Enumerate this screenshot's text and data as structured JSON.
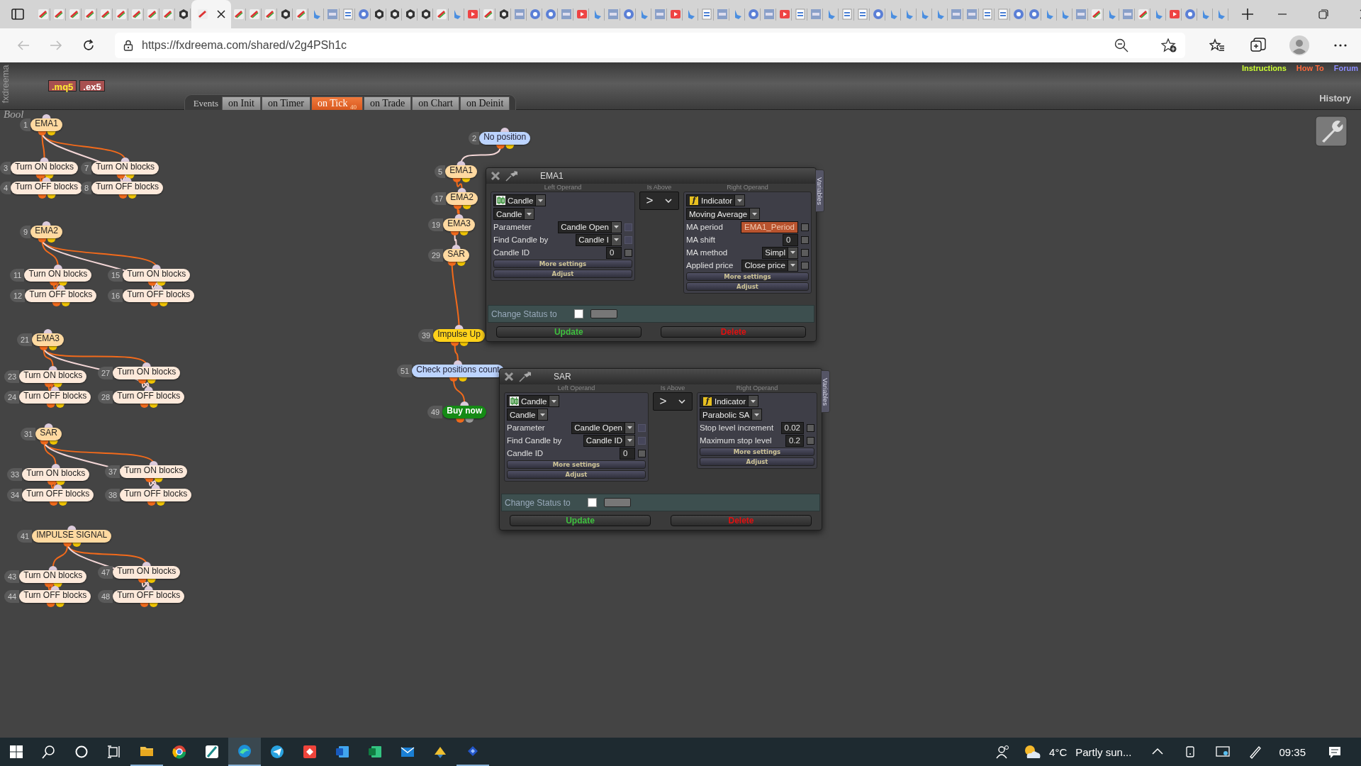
{
  "browser": {
    "url": "https://fxdreema.com/shared/v2g4PSh1c"
  },
  "header": {
    "side_label": "fxdreema",
    "canvas_label": "Bool",
    "downloads": [
      {
        "label": ".mq5",
        "kind": "source"
      },
      {
        "label": ".ex5",
        "kind": "binary"
      }
    ],
    "links": [
      {
        "label": "Instructions",
        "color": "#ccff33"
      },
      {
        "label": "How To",
        "color": "#ff6a3d"
      },
      {
        "label": "Forum",
        "color": "#8c8cff"
      }
    ],
    "history": "History"
  },
  "events_label": "Events",
  "event_tabs": [
    {
      "label": "on Init",
      "selected": false
    },
    {
      "label": "on Timer",
      "selected": false
    },
    {
      "label": "on Tick $_{40}$",
      "selected": true
    },
    {
      "label": "on Trade",
      "selected": false
    },
    {
      "label": "on Chart",
      "selected": false
    },
    {
      "label": "on Deinit",
      "selected": false
    }
  ],
  "blocks": [
    {
      "number": "1",
      "label": "EMA1",
      "kind": "condition"
    },
    {
      "number": "3",
      "label": "Turn ON blocks",
      "kind": "action"
    },
    {
      "number": "7",
      "label": "Turn ON blocks",
      "kind": "action"
    },
    {
      "number": "4",
      "label": "Turn OFF blocks",
      "kind": "action"
    },
    {
      "number": "8",
      "label": "Turn OFF blocks",
      "kind": "action"
    },
    {
      "number": "9",
      "label": "EMA2",
      "kind": "condition"
    },
    {
      "number": "11",
      "label": "Turn ON blocks",
      "kind": "action"
    },
    {
      "number": "15",
      "label": "Turn ON blocks",
      "kind": "action"
    },
    {
      "number": "12",
      "label": "Turn OFF blocks",
      "kind": "action"
    },
    {
      "number": "16",
      "label": "Turn OFF blocks",
      "kind": "action"
    },
    {
      "number": "21",
      "label": "EMA3",
      "kind": "condition"
    },
    {
      "number": "23",
      "label": "Turn ON blocks",
      "kind": "action"
    },
    {
      "number": "27",
      "label": "Turn ON blocks",
      "kind": "action"
    },
    {
      "number": "24",
      "label": "Turn OFF blocks",
      "kind": "action"
    },
    {
      "number": "28",
      "label": "Turn OFF blocks",
      "kind": "action"
    },
    {
      "number": "31",
      "label": "SAR",
      "kind": "condition"
    },
    {
      "number": "33",
      "label": "Turn ON blocks",
      "kind": "action"
    },
    {
      "number": "37",
      "label": "Turn ON blocks",
      "kind": "action"
    },
    {
      "number": "34",
      "label": "Turn OFF blocks",
      "kind": "action"
    },
    {
      "number": "38",
      "label": "Turn OFF blocks",
      "kind": "action"
    },
    {
      "number": "41",
      "label": "IMPULSE SIGNAL",
      "kind": "condition"
    },
    {
      "number": "43",
      "label": "Turn ON blocks",
      "kind": "action"
    },
    {
      "number": "47",
      "label": "Turn ON blocks",
      "kind": "action"
    },
    {
      "number": "44",
      "label": "Turn OFF blocks",
      "kind": "action"
    },
    {
      "number": "48",
      "label": "Turn OFF blocks",
      "kind": "action"
    },
    {
      "number": "2",
      "label": "No position",
      "kind": "filter"
    },
    {
      "number": "5",
      "label": "EMA1",
      "kind": "condition"
    },
    {
      "number": "17",
      "label": "EMA2",
      "kind": "condition"
    },
    {
      "number": "19",
      "label": "EMA3",
      "kind": "condition"
    },
    {
      "number": "29",
      "label": "SAR",
      "kind": "condition"
    },
    {
      "number": "39",
      "label": "Impulse Up",
      "kind": "signal"
    },
    {
      "number": "51",
      "label": "Check positions count",
      "kind": "filter"
    },
    {
      "number": "49",
      "label": "Buy now",
      "kind": "buy"
    }
  ],
  "dialogs": [
    {
      "title": "EMA1",
      "side_tab": "Variables",
      "left_heading": "Left Operand",
      "operator_heading": "Is Above",
      "right_heading": "Right Operand",
      "operator": ">",
      "left": {
        "source": {
          "kind": "candle",
          "label": "Candle"
        },
        "subtype": "Candle",
        "params": [
          {
            "label": "Parameter",
            "kind": "select",
            "value": "Candle Open",
            "checked": false,
            "disabled": true
          },
          {
            "label": "Find Candle by",
            "kind": "select",
            "value": "Candle I",
            "checked": false,
            "disabled": true
          },
          {
            "label": "Candle ID",
            "kind": "number",
            "value": "0",
            "checked": false,
            "disabled": false
          }
        ],
        "buttons": [
          "More settings",
          "Adjust"
        ]
      },
      "right": {
        "source": {
          "kind": "indicator",
          "glyph": "f",
          "label": "Indicator"
        },
        "subtype": "Moving Average",
        "params": [
          {
            "label": "MA period",
            "kind": "variable",
            "value": "EMA1_Period",
            "checked": false,
            "disabled": false
          },
          {
            "label": "MA shift",
            "kind": "number",
            "value": "0",
            "checked": false,
            "disabled": false
          },
          {
            "label": "MA method",
            "kind": "select",
            "value": "Simpl",
            "checked": false,
            "disabled": false
          },
          {
            "label": "Applied price",
            "kind": "select",
            "value": "Close price",
            "checked": false,
            "disabled": false
          }
        ],
        "buttons": [
          "More settings",
          "Adjust"
        ]
      },
      "status": {
        "label": "Change Status to",
        "checked": false
      },
      "actions": [
        {
          "label": "Update",
          "kind": "update"
        },
        {
          "label": "Delete",
          "kind": "delete"
        }
      ]
    },
    {
      "title": "SAR",
      "side_tab": "Variables",
      "left_heading": "Left Operand",
      "operator_heading": "Is Above",
      "right_heading": "Right Operand",
      "operator": ">",
      "left": {
        "source": {
          "kind": "candle",
          "label": "Candle"
        },
        "subtype": "Candle",
        "params": [
          {
            "label": "Parameter",
            "kind": "select",
            "value": "Candle Open",
            "checked": false,
            "disabled": true
          },
          {
            "label": "Find Candle by",
            "kind": "select",
            "value": "Candle ID",
            "checked": false,
            "disabled": true
          },
          {
            "label": "Candle ID",
            "kind": "number",
            "value": "0",
            "checked": false,
            "disabled": false
          }
        ],
        "buttons": [
          "More settings",
          "Adjust"
        ]
      },
      "right": {
        "source": {
          "kind": "indicator",
          "glyph": "f",
          "label": "Indicator"
        },
        "subtype": "Parabolic SA",
        "params": [
          {
            "label": "Stop level increment",
            "kind": "number",
            "value": "0.02",
            "checked": false,
            "disabled": false
          },
          {
            "label": "Maximum stop level",
            "kind": "number",
            "value": "0.2",
            "checked": false,
            "disabled": false
          }
        ],
        "buttons": [
          "More settings",
          "Adjust"
        ]
      },
      "status": {
        "label": "Change Status to",
        "checked": false
      },
      "actions": [
        {
          "label": "Update",
          "kind": "update"
        },
        {
          "label": "Delete",
          "kind": "delete"
        }
      ]
    }
  ],
  "taskbar": {
    "temperature": "4°C",
    "weather": "Partly sun...",
    "time": "09:35"
  }
}
